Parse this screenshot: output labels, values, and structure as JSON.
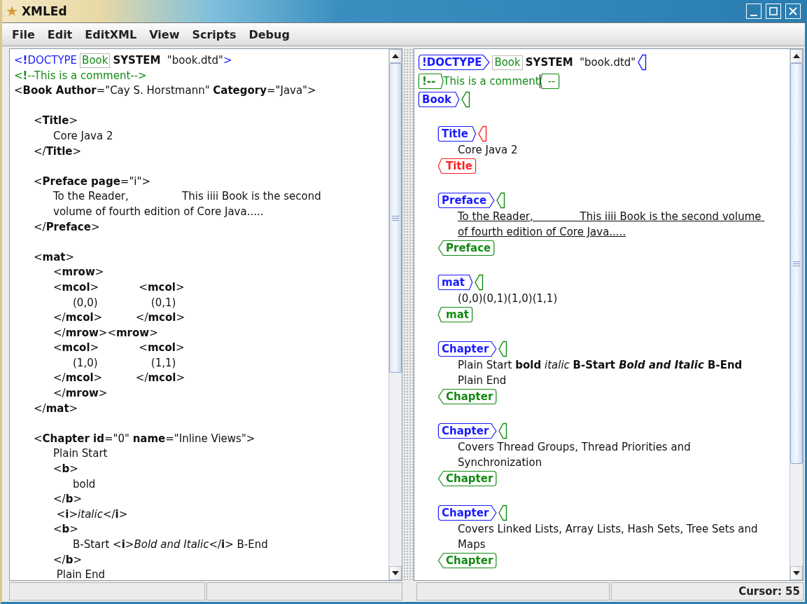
{
  "window": {
    "title": "XMLEd"
  },
  "menu": [
    "File",
    "Edit",
    "EditXML",
    "View",
    "Scripts",
    "Debug"
  ],
  "source": {
    "lines": [
      {
        "kind": "doctype",
        "keyword": "<**!**DOCTYPE",
        "root": "Book",
        "rest": "**SYSTEM**  \"book.dtd\"",
        "close": ">"
      },
      {
        "kind": "comment",
        "text": "<**!**--This is a comment-->"
      },
      {
        "kind": "code",
        "text": "<**Book Author**=\"Cay S. Horstmann\" **Category**=\"Java\">",
        "children": [
          {
            "kind": "blank"
          },
          {
            "kind": "code",
            "text": "<**Title**>",
            "children": [
              {
                "kind": "code",
                "text": "Core Java 2"
              }
            ]
          },
          {
            "kind": "code",
            "text": "</**Title**>"
          },
          {
            "kind": "blank"
          },
          {
            "kind": "code",
            "text": "<**Preface page**=\"i\">",
            "children": [
              {
                "kind": "code",
                "text": "To the Reader,                This iiii Book is the second"
              },
              {
                "kind": "code",
                "text": "volume of fourth edition of Core Java....."
              }
            ]
          },
          {
            "kind": "code",
            "text": "</**Preface**>"
          },
          {
            "kind": "blank"
          },
          {
            "kind": "code",
            "text": "<**mat**>",
            "children": [
              {
                "kind": "code",
                "text": "<**mrow**>"
              },
              {
                "kind": "code",
                "text": "<**mcol**>            <**mcol**>",
                "children": [
                  {
                    "kind": "code",
                    "text": "(0,0)                (0,1)"
                  }
                ]
              },
              {
                "kind": "code",
                "text": "</**mcol**>          </**mcol**>"
              },
              {
                "kind": "code",
                "text": "</**mrow**><**mrow**>"
              },
              {
                "kind": "code",
                "text": "<**mcol**>            <**mcol**>",
                "children": [
                  {
                    "kind": "code",
                    "text": "(1,0)                (1,1)"
                  }
                ]
              },
              {
                "kind": "code",
                "text": "</**mcol**>          </**mcol**>"
              },
              {
                "kind": "code",
                "text": "</**mrow**>"
              }
            ]
          },
          {
            "kind": "code",
            "text": "</**mat**>"
          },
          {
            "kind": "blank"
          },
          {
            "kind": "code",
            "text": "<**Chapter id**=\"0\" **name**=\"Inline Views\">",
            "children": [
              {
                "kind": "code",
                "text": "Plain Start"
              },
              {
                "kind": "code",
                "text": "<**b**>",
                "children": [
                  {
                    "kind": "code",
                    "text": "bold"
                  }
                ]
              },
              {
                "kind": "code",
                "text": "</**b**>"
              },
              {
                "kind": "code",
                "text": " <**i**>*italic*</**i**>"
              },
              {
                "kind": "code",
                "text": "<**b**>",
                "children": [
                  {
                    "kind": "code",
                    "text": "B-Start <**i**>*Bold and Italic*</**i**> B-End"
                  }
                ]
              },
              {
                "kind": "code",
                "text": "</**b**>"
              },
              {
                "kind": "code",
                "text": " Plain End"
              }
            ]
          }
        ]
      }
    ]
  },
  "view": {
    "nodes": [
      {
        "kind": "doctype",
        "tag": "!DOCTYPE",
        "root": "Book",
        "rest": "**SYSTEM**  \"book.dtd\""
      },
      {
        "kind": "comment",
        "tag": "!--",
        "text": "This is a comment",
        "caret": true,
        "close_tag": "--"
      },
      {
        "kind": "element",
        "tag": "Book",
        "invalid": false,
        "children": [
          {
            "kind": "element",
            "tag": "Title",
            "invalid": true,
            "text": "Core Java 2",
            "underlined": false,
            "close_tag": "Title"
          },
          {
            "kind": "element",
            "tag": "Preface",
            "invalid": false,
            "text": "To the Reader,              This iiii Book is the second volume of fourth edition of Core Java.....",
            "underlined": true,
            "close_tag": "Preface"
          },
          {
            "kind": "element",
            "tag": "mat",
            "invalid": false,
            "text": "(0,0)(0,1)(1,0)(1,1)",
            "underlined": false,
            "close_tag": "mat"
          },
          {
            "kind": "element",
            "tag": "Chapter",
            "invalid": false,
            "text": "Plain Start **bold** *italic* **B-Start *Bold and Italic* B-End** Plain End",
            "underlined": false,
            "close_tag": "Chapter"
          },
          {
            "kind": "element",
            "tag": "Chapter",
            "invalid": false,
            "text": "Covers Thread Groups, Thread Priorities and Synchronization",
            "underlined": false,
            "close_tag": "Chapter"
          },
          {
            "kind": "element",
            "tag": "Chapter",
            "invalid": false,
            "text": "Covers Linked Lists, Array Lists, Hash Sets, Tree Sets and Maps",
            "underlined": false,
            "close_tag": "Chapter"
          }
        ]
      }
    ]
  },
  "status_bar": {
    "cursor": "Cursor: 55"
  }
}
